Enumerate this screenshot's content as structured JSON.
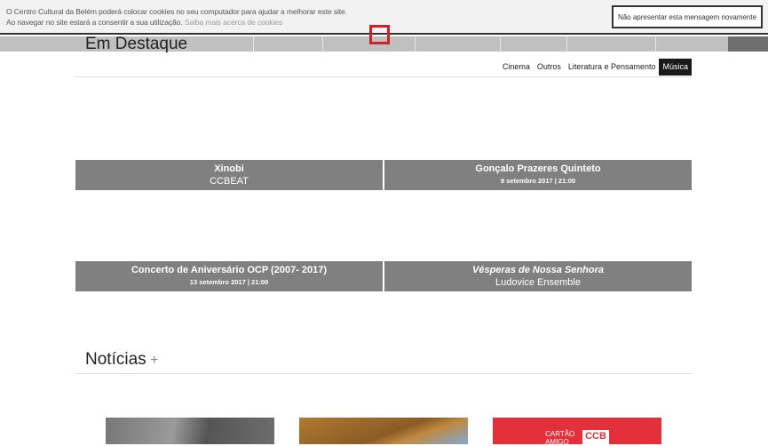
{
  "cookie_bar": {
    "line1": "O Centro Cultural da Belém poderá colocar cookies no seu computador para ajudar a melhorar este site.",
    "line2": "Ao navegar no site estará a consentir a sua utilização.",
    "link": "Saiba mais acerca de cookies",
    "dismiss_button": "Não apresentar esta mensagem novamente"
  },
  "featured": {
    "title": "Em Destaque",
    "tabs": [
      "Cinema",
      "Outros",
      "Literatura e Pensamento",
      "Música"
    ],
    "active_tab": "Música",
    "cards": [
      {
        "title": "Xinobi",
        "subtitle": "CCBEAT"
      },
      {
        "title": "Gonçalo Prazeres Quinteto",
        "date": "9 setembro 2017 | 21:00"
      },
      {
        "title": "Concerto de Aniversário OCP (2007- 2017)",
        "date": "13 setembro 2017 | 21:00"
      },
      {
        "title": "Vésperas de Nossa Senhora",
        "subtitle": "Ludovice Ensemble"
      }
    ]
  },
  "news": {
    "title": "Notícias",
    "plus": "+",
    "promo_text": "CARTÃO AMIGO",
    "promo_logo": "CCB"
  }
}
